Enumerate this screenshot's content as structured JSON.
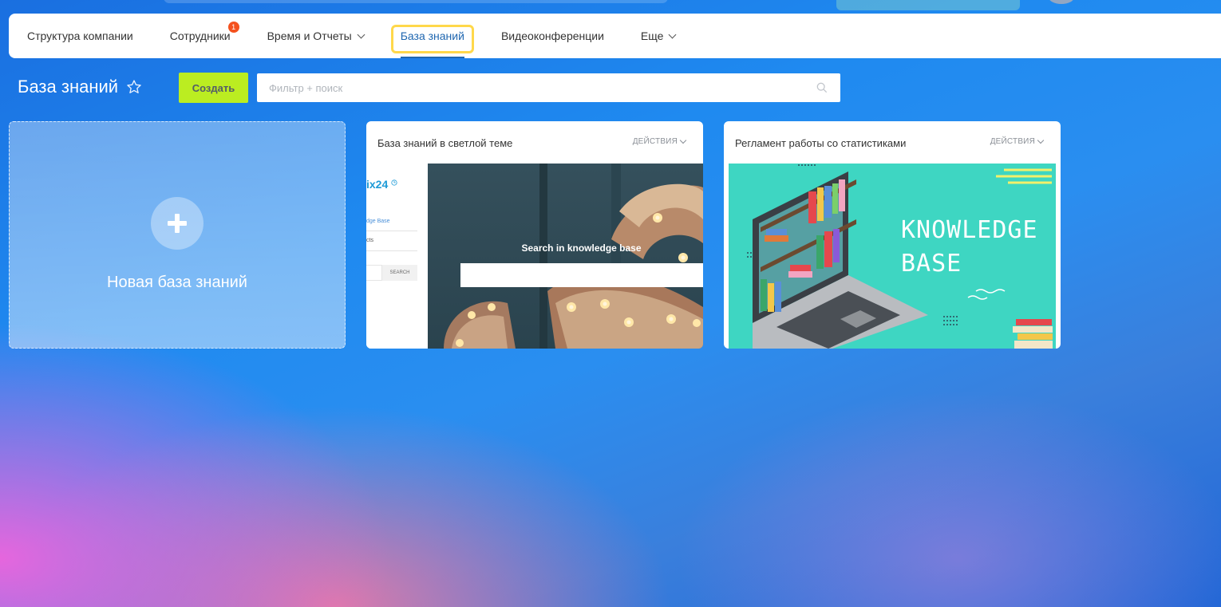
{
  "nav": {
    "items": [
      {
        "label": "Структура компании"
      },
      {
        "label": "Сотрудники",
        "badge": "1"
      },
      {
        "label": "Время и Отчеты"
      },
      {
        "label": "База знаний"
      },
      {
        "label": "Видеоконференции"
      },
      {
        "label": "Еще"
      }
    ],
    "active_index": 3
  },
  "toolbar": {
    "page_title": "База знаний",
    "create_label": "Создать",
    "search_placeholder": "Фильтр + поиск"
  },
  "new_card": {
    "label": "Новая база знаний"
  },
  "cards": [
    {
      "title": "База знаний в светлой теме",
      "actions_label": "ДЕЙСТВИЯ",
      "preview": {
        "logo": "ix24",
        "link": "dge Base",
        "text": "cts",
        "button": "SEARCH",
        "heading": "Search in knowledge base"
      }
    },
    {
      "title": "Регламент работы со статистиками",
      "actions_label": "ДЕЙСТВИЯ",
      "preview": {
        "line1": "KNOWLEDGE",
        "line2": "BASE"
      }
    }
  ],
  "colors": {
    "accent_green": "#bbed21",
    "badge_red": "#f4511e",
    "active_blue": "#2067b0",
    "highlight_yellow": "#ffd84a"
  }
}
